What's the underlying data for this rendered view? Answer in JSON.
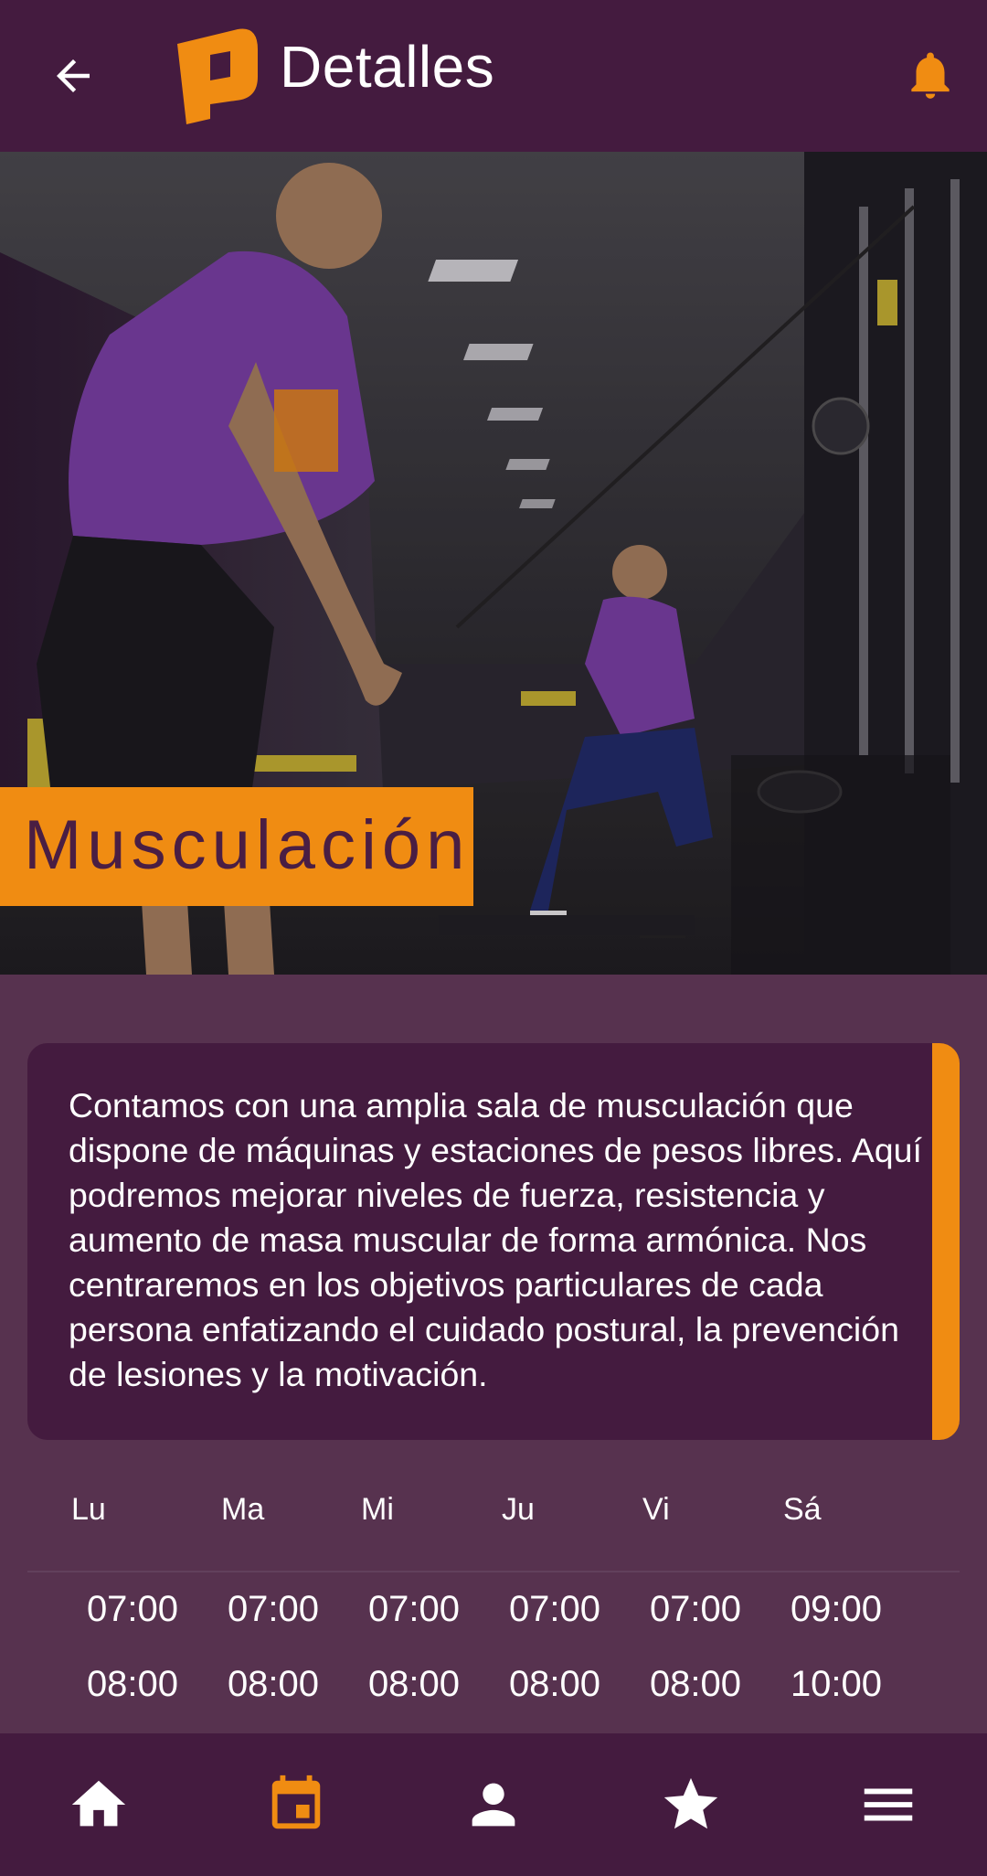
{
  "app": {
    "title": "Detalles",
    "colors": {
      "appbar": "#441b3f",
      "background": "#57324f",
      "accent": "#f08c12",
      "text": "#ffffff"
    }
  },
  "header": {
    "back_icon": "arrow-left-icon",
    "logo_icon": "p-logo-icon",
    "notification_icon": "bell-icon"
  },
  "hero": {
    "title": "Musculación",
    "image": "gym-photo"
  },
  "description": "Contamos con una amplia sala de musculación que dispone de máquinas y estaciones de pesos libres. Aquí podremos mejorar niveles de fuerza, resistencia y aumento de masa muscular de forma armónica. Nos centraremos en los objetivos particulares de cada persona enfatizando el cuidado postural, la prevención de lesiones y la motivación.",
  "schedule": {
    "days": [
      "Lu",
      "Ma",
      "Mi",
      "Ju",
      "Vi",
      "Sá"
    ],
    "rows": [
      [
        "07:00",
        "07:00",
        "07:00",
        "07:00",
        "07:00",
        "09:00"
      ],
      [
        "08:00",
        "08:00",
        "08:00",
        "08:00",
        "08:00",
        "10:00"
      ]
    ]
  },
  "bottom_nav": {
    "items": [
      {
        "icon": "home-icon",
        "active": false
      },
      {
        "icon": "calendar-icon",
        "active": true
      },
      {
        "icon": "person-icon",
        "active": false
      },
      {
        "icon": "star-icon",
        "active": false
      },
      {
        "icon": "menu-icon",
        "active": false
      }
    ]
  }
}
